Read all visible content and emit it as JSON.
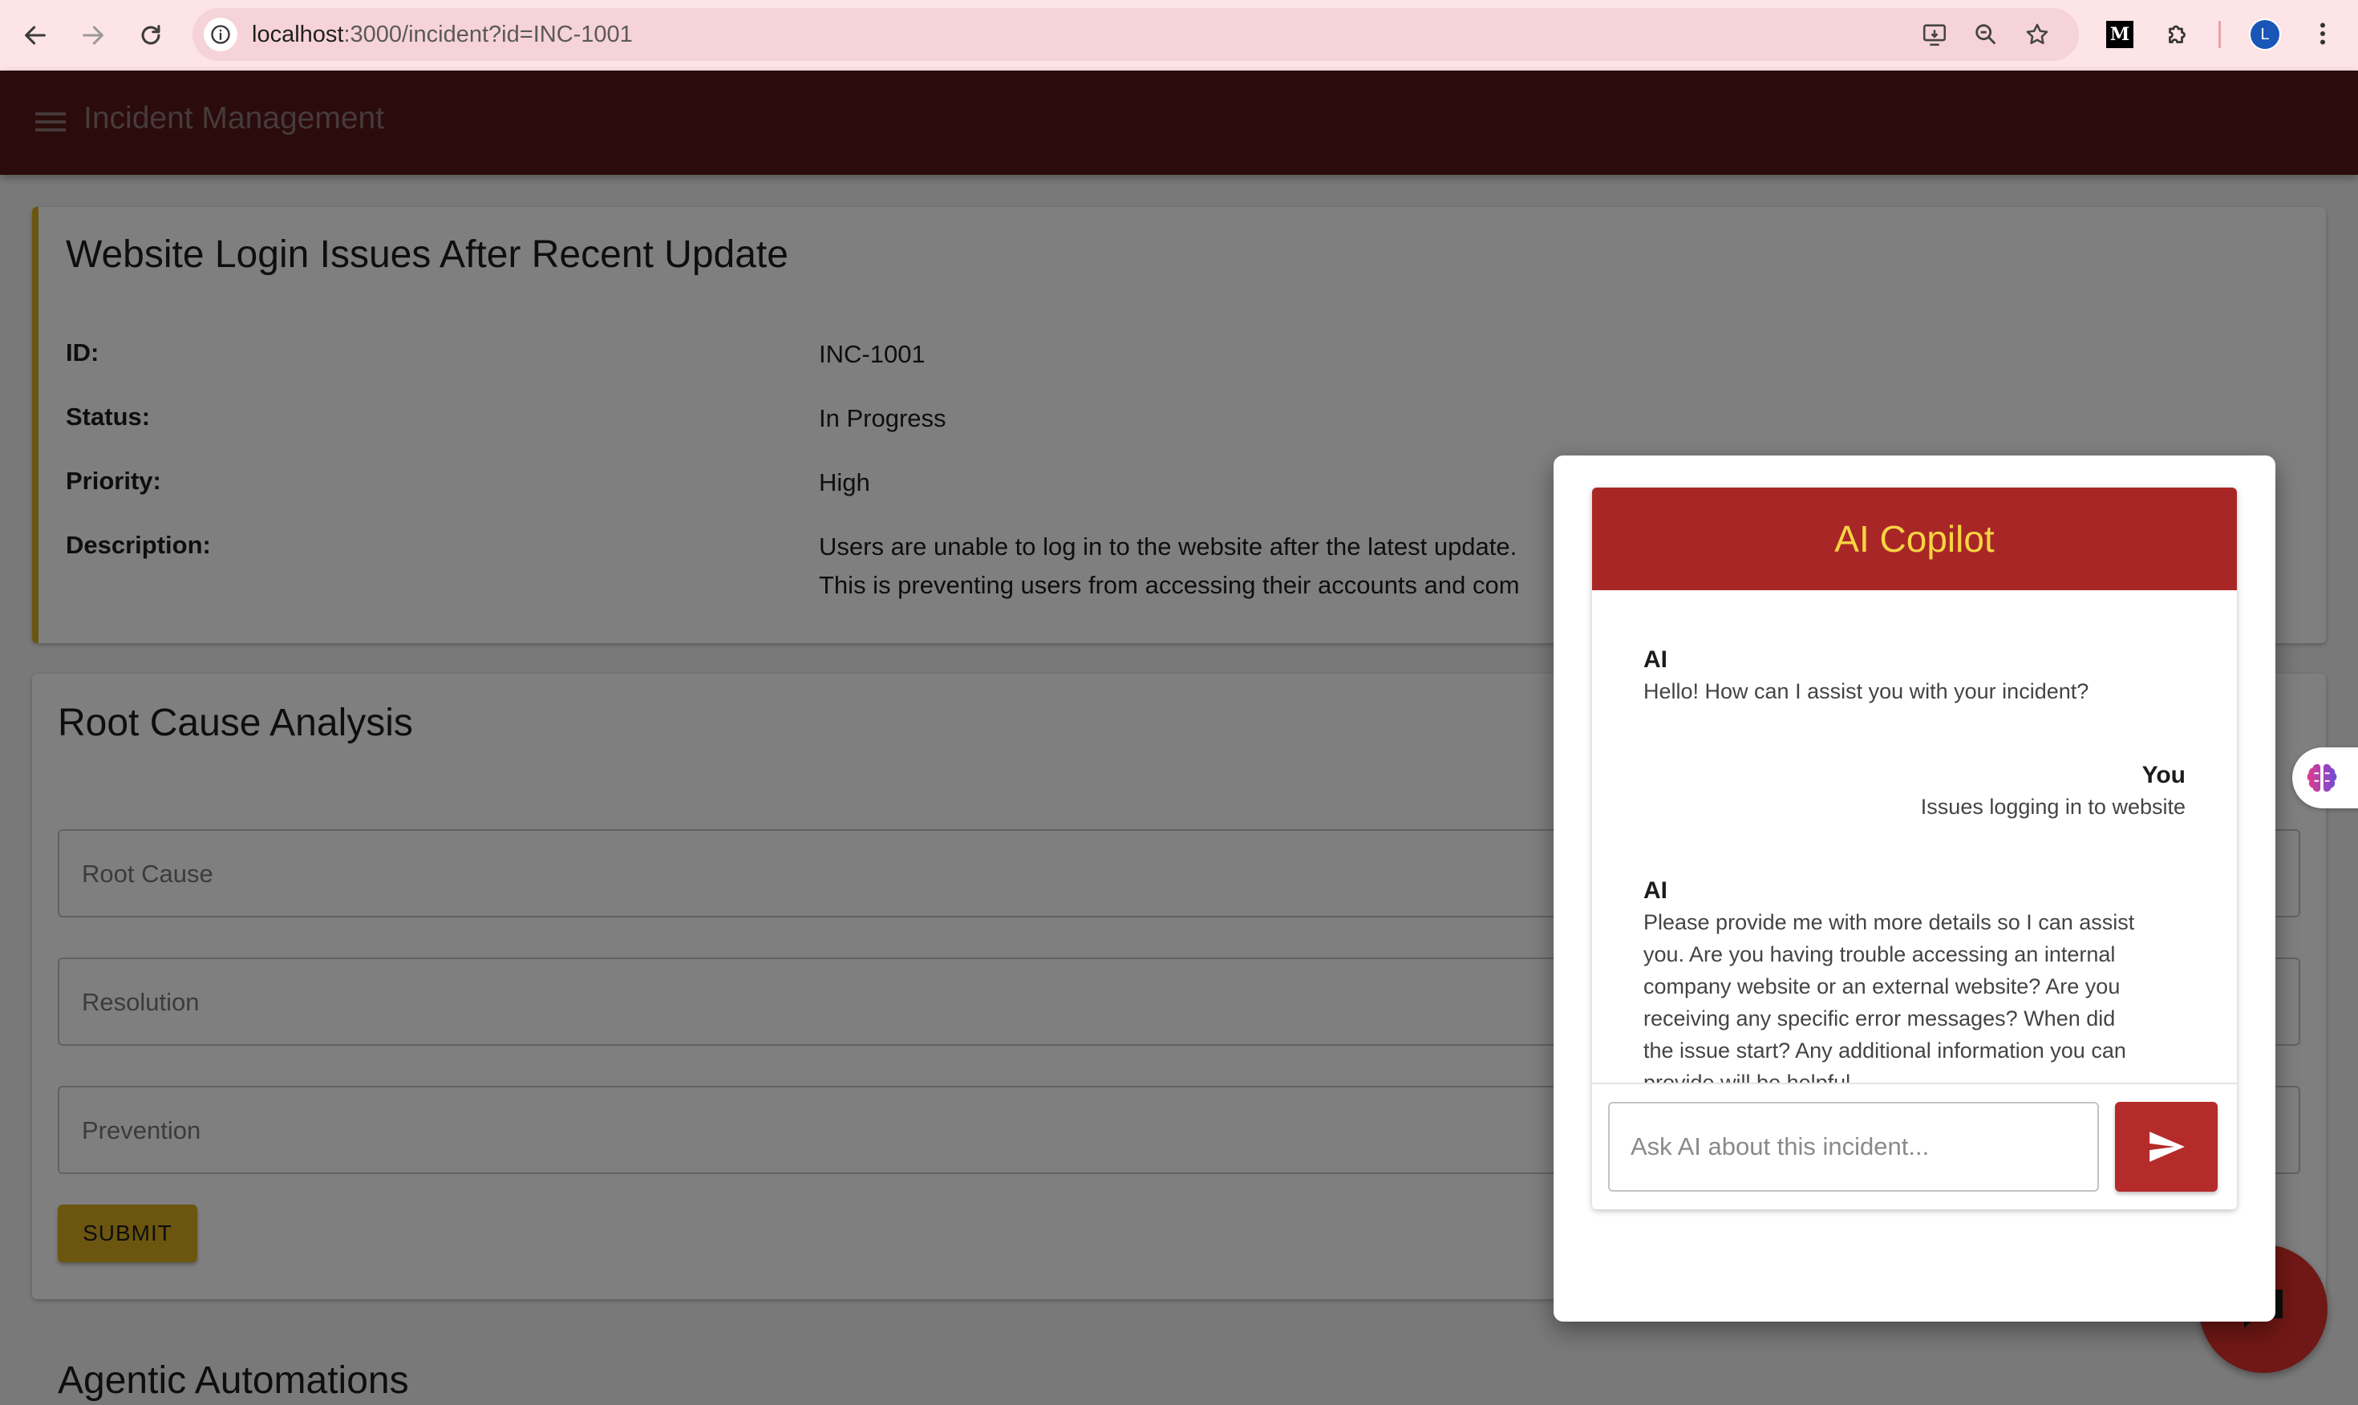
{
  "browser": {
    "url_host": "localhost",
    "url_path": ":3000/incident?id=INC-1001",
    "profile_initial": "L"
  },
  "app": {
    "title": "Incident Management"
  },
  "incident": {
    "title": "Website Login Issues After Recent Update",
    "fields": {
      "id_label": "ID:",
      "id_value": "INC-1001",
      "status_label": "Status:",
      "status_value": "In Progress",
      "priority_label": "Priority:",
      "priority_value": "High",
      "description_label": "Description:",
      "description_line1": "Users are unable to log in to the website after the latest update.",
      "description_line2": "This is preventing users from accessing their accounts and com"
    }
  },
  "rca": {
    "title": "Root Cause Analysis",
    "root_cause_label": "Root Cause",
    "resolution_label": "Resolution",
    "prevention_label": "Prevention",
    "submit_label": "SUBMIT"
  },
  "agentic": {
    "title": "Agentic Automations"
  },
  "copilot": {
    "title": "AI Copilot",
    "messages": [
      {
        "author": "AI",
        "lines": [
          "Hello! How can I assist you with your incident?"
        ]
      },
      {
        "author": "You",
        "lines": [
          "Issues logging in to website"
        ]
      },
      {
        "author": "AI",
        "lines": [
          "Please provide me with more details so I can assist",
          "you. Are you having trouble accessing an internal",
          "company website or an external website? Are you",
          "receiving any specific error messages? When did",
          "the issue start? Any additional information you can",
          "provide will be helpful."
        ]
      }
    ],
    "input_placeholder": "Ask AI about this incident..."
  },
  "colors": {
    "appbar": "#561616",
    "accent_yellow": "#d9ac1e",
    "copilot_header": "#a82726",
    "copilot_title": "#f8d443",
    "send_button": "#b52b2a",
    "fab": "#e0302a"
  },
  "icons": {
    "back": "arrow-left-icon",
    "forward": "arrow-right-icon",
    "reload": "reload-icon",
    "site_info": "info-icon",
    "install": "install-app-icon",
    "zoom": "zoom-icon",
    "bookmark": "star-icon",
    "medium": "medium-logo-icon",
    "extensions": "puzzle-icon",
    "more": "more-vertical-icon",
    "menu": "hamburger-menu-icon",
    "send": "send-icon",
    "chat": "chat-bubble-icon",
    "brain": "brain-icon"
  }
}
